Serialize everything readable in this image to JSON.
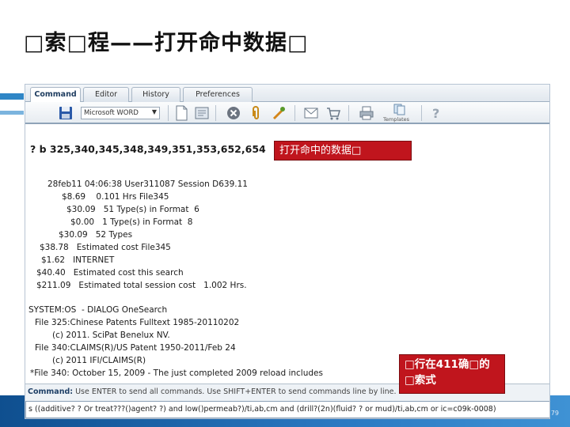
{
  "slide": {
    "title": "□索□程——打开命中数据□",
    "page_number": "79"
  },
  "tabs": [
    {
      "label": "Command",
      "active": true
    },
    {
      "label": "Editor",
      "active": false
    },
    {
      "label": "History",
      "active": false
    },
    {
      "label": "Preferences",
      "active": false
    }
  ],
  "toolbar": {
    "format_select": "Microsoft WORD",
    "templates_label": "Templates",
    "icons": [
      "save-icon",
      "new-document-icon",
      "print-preview-icon",
      "cancel-icon",
      "attach-icon",
      "tools-icon",
      "mail-icon",
      "cart-icon",
      "printer-icon",
      "templates-icon",
      "help-icon"
    ]
  },
  "output": {
    "command": "? b 325,340,345,348,349,351,353,652,654",
    "lines": [
      "28feb11 04:06:38 User311087 Session D639.11",
      "$8.69    0.101 Hrs File345",
      "$30.09   51 Type(s) in Format  6",
      "$0.00   1 Type(s) in Format  8",
      "$30.09   52 Types",
      "$38.78   Estimated cost File345",
      "$1.62   INTERNET",
      "$40.40   Estimated cost this search",
      "$211.09   Estimated total session cost   1.002 Hrs.",
      "SYSTEM:OS  - DIALOG OneSearch",
      "File 325:Chinese Patents Fulltext 1985-20110202",
      "(c) 2011. SciPat Benelux NV.",
      "File 340:CLAIMS(R)/US Patent 1950-2011/Feb 24",
      "(c) 2011 IFI/CLAIMS(R)",
      "*File 340: October 15, 2009 - The just completed 2009 reload includes"
    ]
  },
  "status": {
    "prefix": "Command:",
    "text": " Use ENTER to send all commands. Use SHIFT+ENTER to send commands line by line."
  },
  "query": {
    "value": "s ((additive? ? Or treat???()agent? ?) and low()permeab?)/ti,ab,cm and (drill?(2n)(fluid? ? or mud)/ti,ab,cm or ic=c09k-0008)"
  },
  "callouts": {
    "open_hit_data": "打开命中的数据□",
    "existing_query": "□行在411确□的□索式"
  },
  "colors": {
    "callout_bg": "#c0151d",
    "accent_blue": "#2f86c6"
  }
}
